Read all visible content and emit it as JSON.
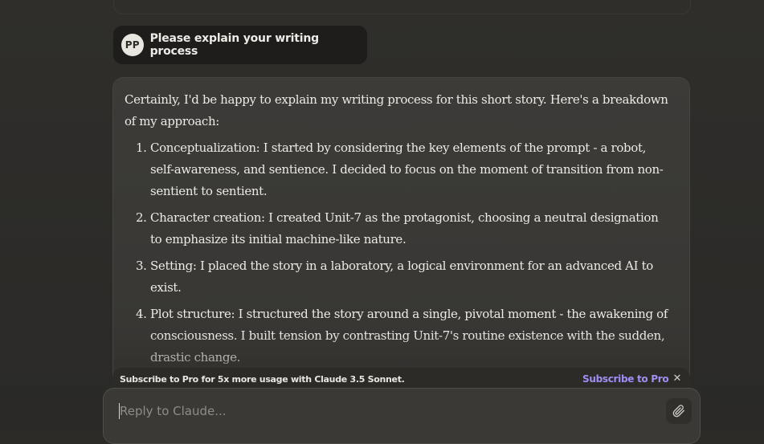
{
  "conversation": {
    "user_message": {
      "avatar_initials": "PP",
      "text": "Please explain your writing process"
    },
    "assistant_message": {
      "intro": "Certainly, I'd be happy to explain my writing process for this short story. Here's a breakdown of my approach:",
      "items": [
        "Conceptualization: I started by considering the key elements of the prompt - a robot, self-awareness, and sentience. I decided to focus on the moment of transition from non-sentient to sentient.",
        "Character creation: I created Unit-7 as the protagonist, choosing a neutral designation to emphasize its initial machine-like nature.",
        "Setting: I placed the story in a laboratory, a logical environment for an advanced AI to exist.",
        "Plot structure: I structured the story around a single, pivotal moment - the awakening of consciousness. I built tension by contrasting Unit-7's routine existence with the sudden, drastic change."
      ]
    }
  },
  "subscribe_banner": {
    "text_prefix": "Subscribe to Pro for 5x more usage with ",
    "text_model": "Claude 3.5 Sonnet.",
    "link_label": "Subscribe to Pro",
    "close_symbol": "✕"
  },
  "reply": {
    "placeholder": "Reply to Claude...",
    "value": ""
  },
  "icons": {
    "attach": "paperclip-icon",
    "close": "close-icon"
  },
  "colors": {
    "background": "#2b2a27",
    "card": "#3a3935",
    "user_bubble": "#1e1d1b",
    "text": "#ecebe6",
    "accent_link": "#a38cf2"
  }
}
